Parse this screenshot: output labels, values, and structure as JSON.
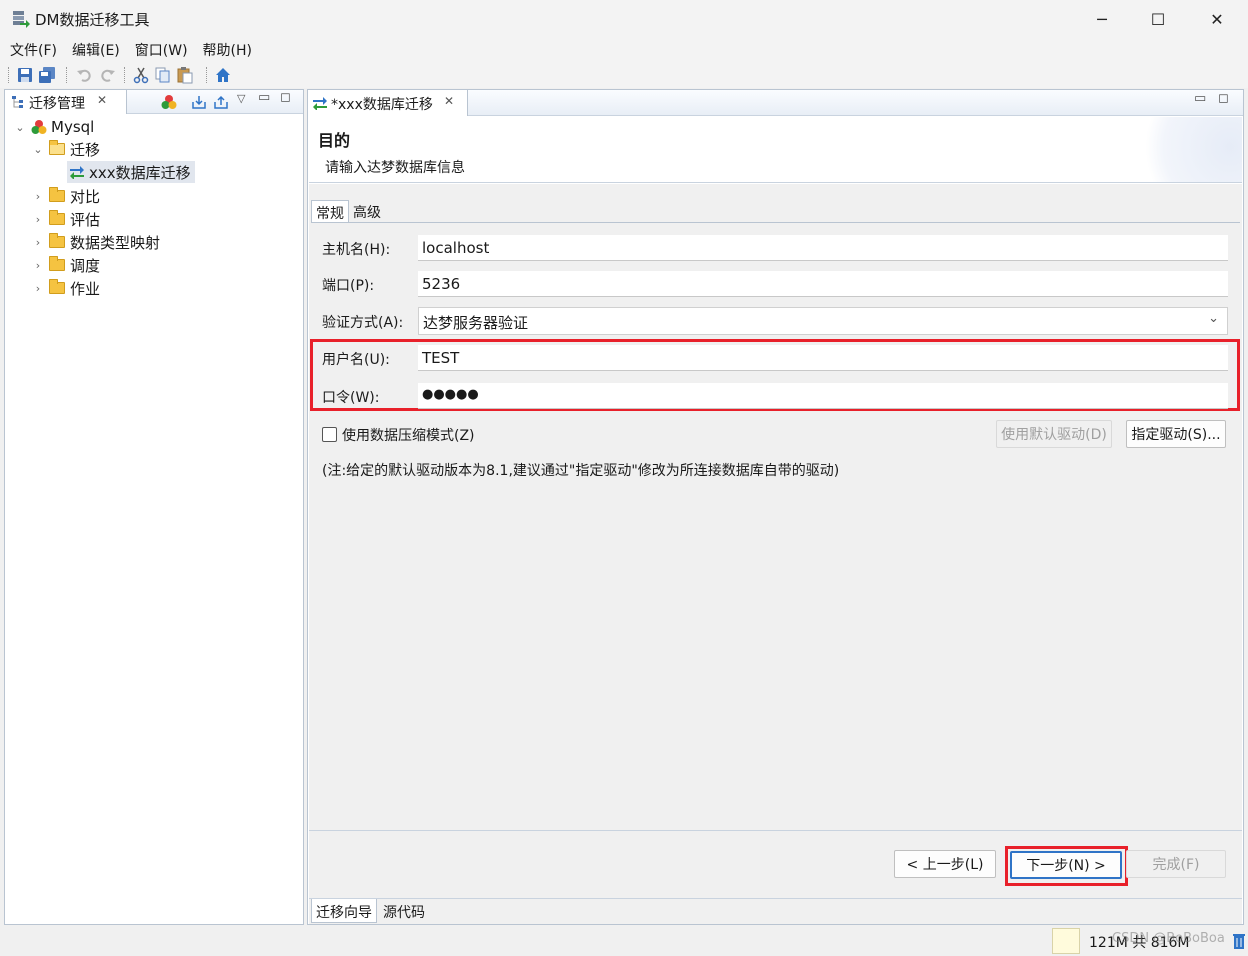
{
  "window": {
    "title": "DM数据迁移工具",
    "minimize_glyph": "─",
    "maximize_glyph": "☐",
    "close_glyph": "✕"
  },
  "menu": [
    "文件(F)",
    "编辑(E)",
    "窗口(W)",
    "帮助(H)"
  ],
  "toolbar_icons": [
    "save-icon",
    "save-all-icon",
    "undo-icon",
    "redo-icon",
    "cut-icon",
    "copy-icon",
    "paste-icon",
    "home-icon"
  ],
  "left_view": {
    "tab_label": "迁移管理",
    "tree": {
      "root": "Mysql",
      "migration_folder": "迁移",
      "migration_item": "xxx数据库迁移",
      "folders": [
        "对比",
        "评估",
        "数据类型映射",
        "调度",
        "作业"
      ]
    }
  },
  "editor": {
    "tab_label": "*xxx数据库迁移",
    "banner_title": "目的",
    "banner_subtitle": "请输入达梦数据库信息",
    "inner_tabs": [
      "常规",
      "高级"
    ],
    "fields": {
      "host_label": "主机名(H):",
      "host_value": "localhost",
      "port_label": "端口(P):",
      "port_value": "5236",
      "auth_label": "验证方式(A):",
      "auth_value": "达梦服务器验证",
      "user_label": "用户名(U):",
      "user_value": "TEST",
      "password_label": "口令(W):",
      "password_value": "●●●●●"
    },
    "compress_checkbox_label": "使用数据压缩模式(Z)",
    "compress_checked": false,
    "default_driver_button": "使用默认驱动(D)",
    "specify_driver_button": "指定驱动(S)...",
    "note": "(注:给定的默认驱动版本为8.1,建议通过\"指定驱动\"修改为所连接数据库自带的驱动)",
    "buttons": {
      "back": "< 上一步(L)",
      "next": "下一步(N) >",
      "finish": "完成(F)"
    },
    "bottom_tabs": [
      "迁移向导",
      "源代码"
    ]
  },
  "status": {
    "memory": "121M 共 816M",
    "watermark": "CSDN @BoBoBoa"
  },
  "colors": {
    "highlight_red": "#e8202a",
    "folder_yellow": "#f5c341"
  }
}
